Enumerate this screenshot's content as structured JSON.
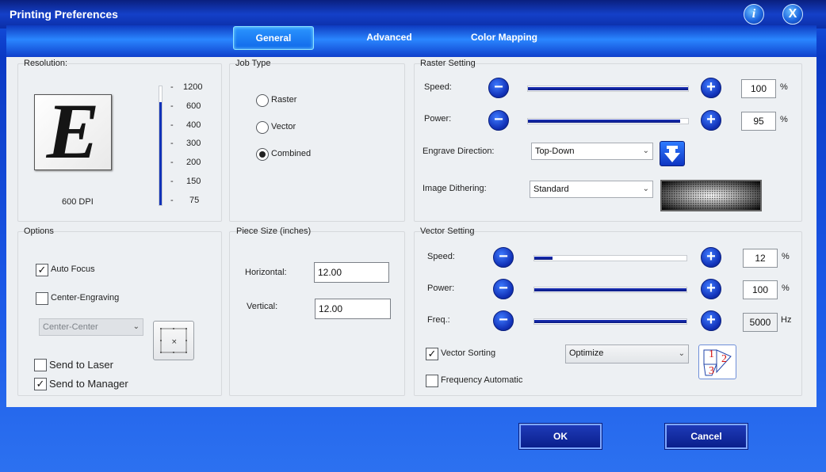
{
  "window": {
    "title": "Printing Preferences",
    "info_label": "i",
    "close_label": "X"
  },
  "tabs": [
    {
      "label": "General",
      "active": true
    },
    {
      "label": "Advanced",
      "active": false
    },
    {
      "label": "Color Mapping",
      "active": false
    }
  ],
  "resolution": {
    "title": "Resolution:",
    "preview_letter": "E",
    "dpi_label": "600 DPI",
    "ticks": [
      "1200",
      "600",
      "400",
      "300",
      "200",
      "150",
      "75"
    ],
    "selected": "600"
  },
  "job_type": {
    "title": "Job Type",
    "options": [
      {
        "label": "Raster",
        "selected": false
      },
      {
        "label": "Vector",
        "selected": false
      },
      {
        "label": "Combined",
        "selected": true
      }
    ]
  },
  "raster": {
    "title": "Raster Setting",
    "speed": {
      "label": "Speed:",
      "value": "100",
      "unit": "%",
      "fraction": 1.0
    },
    "power": {
      "label": "Power:",
      "value": "95",
      "unit": "%",
      "fraction": 0.95
    },
    "engrave_direction": {
      "label": "Engrave Direction:",
      "value": "Top-Down"
    },
    "dithering": {
      "label": "Image Dithering:",
      "value": "Standard"
    }
  },
  "options": {
    "title": "Options",
    "auto_focus": {
      "label": "Auto Focus",
      "checked": true
    },
    "center_engraving": {
      "label": "Center-Engraving",
      "checked": false
    },
    "center_position": "Center-Center",
    "send_to_laser": {
      "label": "Send to Laser",
      "checked": false
    },
    "send_to_manager": {
      "label": "Send to Manager",
      "checked": true
    }
  },
  "piece_size": {
    "title": "Piece Size (inches)",
    "horizontal": {
      "label": "Horizontal:",
      "value": "12.00"
    },
    "vertical": {
      "label": "Vertical:",
      "value": "12.00"
    }
  },
  "vector": {
    "title": "Vector Setting",
    "speed": {
      "label": "Speed:",
      "value": "12",
      "unit": "%",
      "fraction": 0.12
    },
    "power": {
      "label": "Power:",
      "value": "100",
      "unit": "%",
      "fraction": 1.0
    },
    "freq": {
      "label": "Freq.:",
      "value": "5000",
      "unit": "Hz",
      "fraction": 1.0
    },
    "vector_sorting": {
      "label": "Vector Sorting",
      "checked": true,
      "value": "Optimize"
    },
    "frequency_automatic": {
      "label": "Frequency Automatic",
      "checked": false
    },
    "sort_order": [
      "1",
      "2",
      "3"
    ]
  },
  "footer": {
    "ok_label": "OK",
    "cancel_label": "Cancel"
  },
  "colors": {
    "accent": "#1232b8",
    "slider_fill": "#0a1a80"
  }
}
